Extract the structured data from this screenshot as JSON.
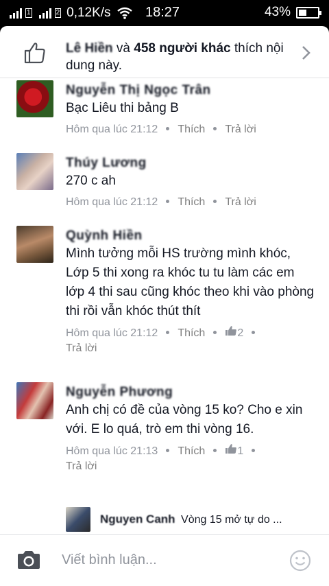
{
  "status": {
    "net_speed": "0,12K/s",
    "time": "18:27",
    "battery": "43%",
    "battery_level": 0.43
  },
  "likes": {
    "name": "Lê Hiền",
    "conj": " và ",
    "others": "458 người khác",
    "rest": " thích nội dung này."
  },
  "comments": [
    {
      "name": "Nguyễn Thị Ngọc Trân",
      "text": "Bạc Liêu thi bảng B",
      "time": "Hôm qua lúc 21:12",
      "like_label": "Thích",
      "reply_label": "Trả lời",
      "likes": ""
    },
    {
      "name": "Thúy Lương",
      "text": "270 c ah",
      "time": "Hôm qua lúc 21:12",
      "like_label": "Thích",
      "reply_label": "Trả lời",
      "likes": ""
    },
    {
      "name": "Quỳnh Hiền",
      "text": "Mình tưởng mỗi HS trường mình khóc, Lớp 5 thi xong ra khóc tu tu làm các em lớp 4 thi sau cũng khóc theo khi vào phòng thi rồi vẫn khóc thút thít",
      "time": "Hôm qua lúc 21:12",
      "like_label": "Thích",
      "reply_label": "Trả lời",
      "likes": "2"
    },
    {
      "name": "Nguyễn Phương",
      "text": "Anh chị có đề của vòng 15 ko? Cho e xin với. E lo quá, trò em thi vòng 16.",
      "time": "Hôm qua lúc 21:13",
      "like_label": "Thích",
      "reply_label": "Trả lời",
      "likes": "1"
    }
  ],
  "reply": {
    "name": "Nguyen Canh",
    "text": "Vòng 15 mở tự do ..."
  },
  "composer": {
    "placeholder": "Viết bình luận..."
  },
  "icons": {
    "like": "thumbs-up-outline-icon",
    "chevron": "chevron-right-icon",
    "camera": "camera-icon",
    "smile": "smiley-icon"
  },
  "colors": {
    "text": "#141823",
    "meta": "#90949c",
    "divider": "#e1e2e5"
  }
}
